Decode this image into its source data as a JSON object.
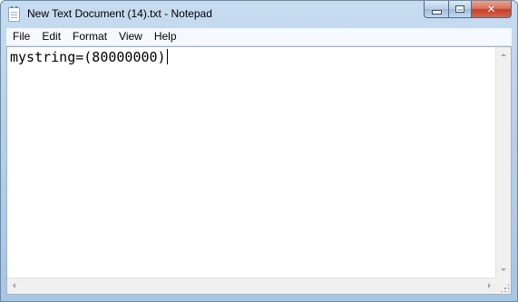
{
  "window": {
    "title": "New Text Document (14).txt - Notepad",
    "icon": "notepad-icon"
  },
  "caption_buttons": {
    "minimize_icon": "minimize-icon",
    "maximize_icon": "maximize-icon",
    "close_glyph": "✕"
  },
  "menu": {
    "items": [
      {
        "label": "File"
      },
      {
        "label": "Edit"
      },
      {
        "label": "Format"
      },
      {
        "label": "View"
      },
      {
        "label": "Help"
      }
    ]
  },
  "editor": {
    "content": "mystring=(80000000)"
  },
  "colors": {
    "close_button": "#c4402a",
    "frame": "#b8d0ea"
  }
}
